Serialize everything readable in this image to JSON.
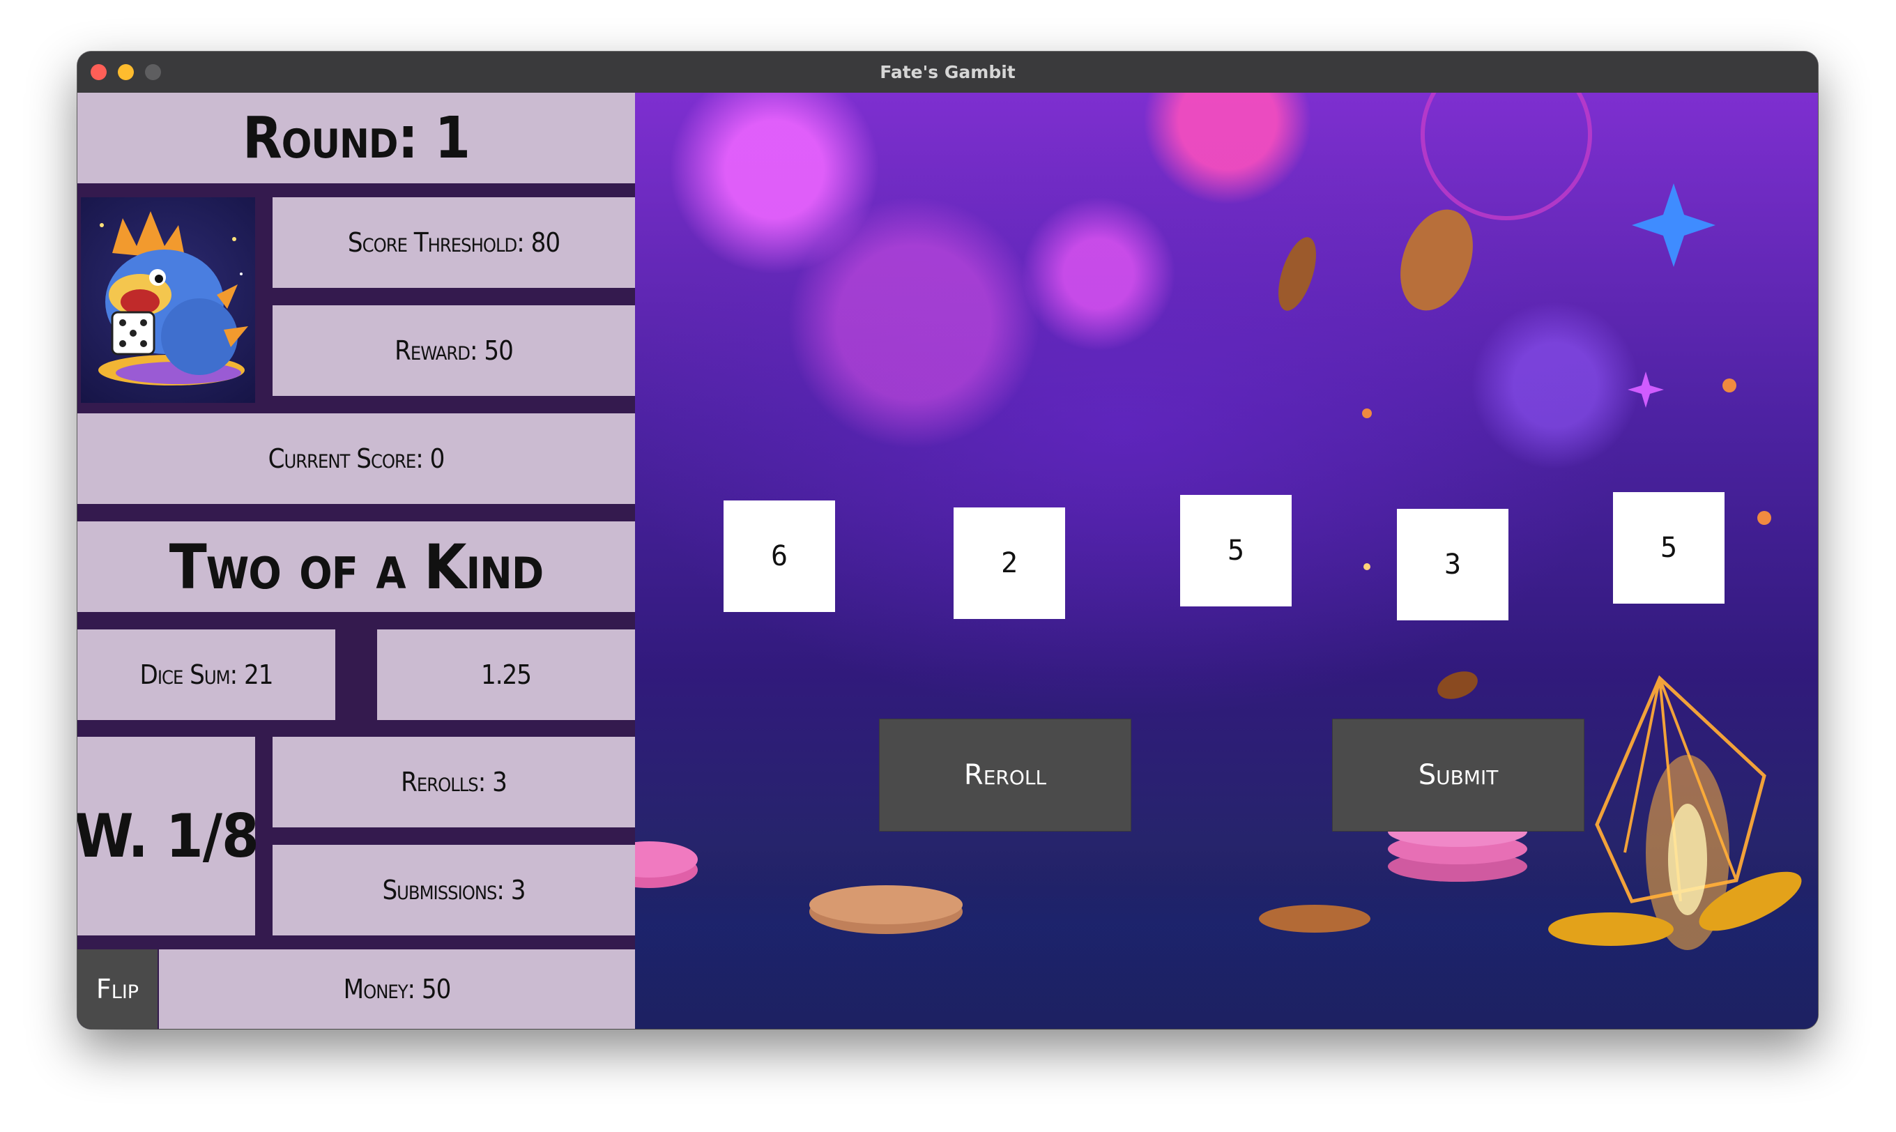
{
  "window": {
    "title": "Fate's Gambit"
  },
  "hud": {
    "round": "Round: 1",
    "score_threshold": "Score Threshold: 80",
    "reward": "Reward: 50",
    "current_score": "Current Score: 0",
    "hand_name": "Two of a Kind",
    "dice_sum": "Dice Sum: 21",
    "multiplier": "1.25",
    "week": "W. 1/8",
    "rerolls": "Rerolls: 3",
    "submissions": "Submissions: 3",
    "flip_label": "Flip",
    "money": "Money: 50"
  },
  "dice": [
    "6",
    "2",
    "5",
    "3",
    "5"
  ],
  "actions": {
    "reroll_label": "Reroll",
    "submit_label": "Submit"
  },
  "colors": {
    "panel": "#e4d6e6",
    "button": "#4b4b4b",
    "die_face": "#ffffff",
    "background_purple": "#4d22a2"
  }
}
